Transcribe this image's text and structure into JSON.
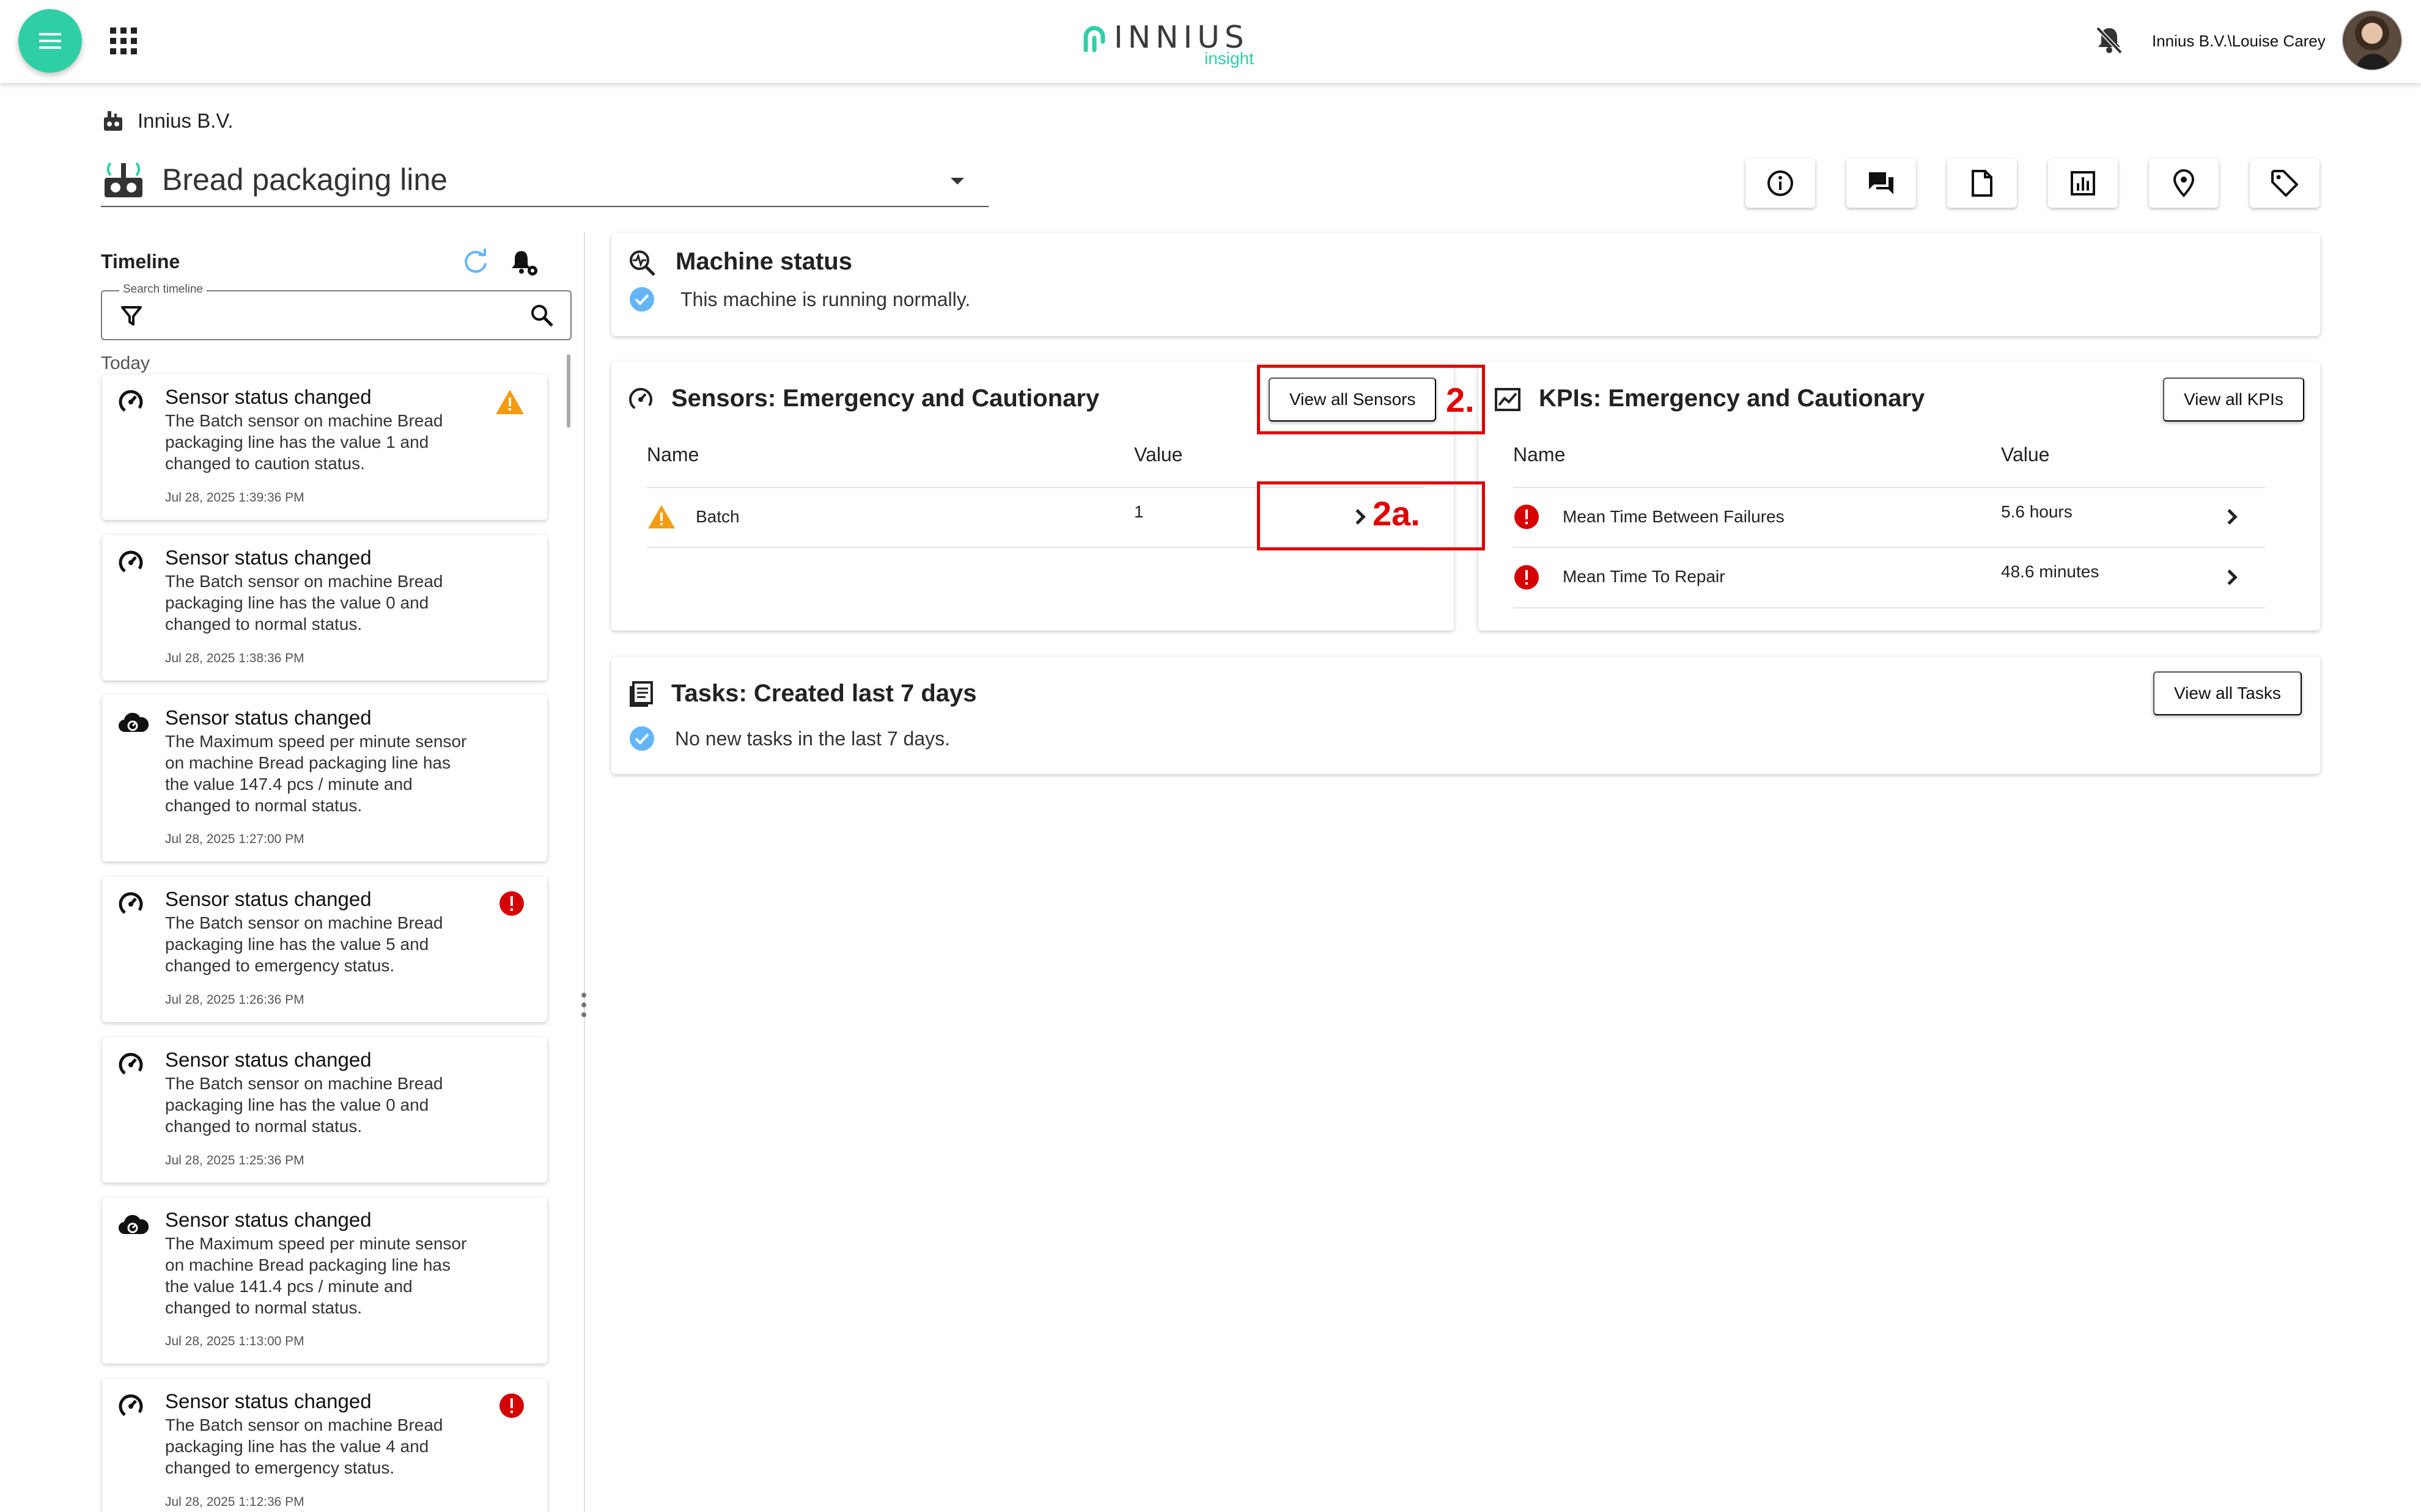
{
  "header": {
    "logo_word": "INNIUS",
    "logo_sub": "insight",
    "user": "Innius B.V.\\Louise Carey"
  },
  "breadcrumb": "Innius B.V.",
  "machine_selector": "Bread packaging line",
  "timeline": {
    "title": "Timeline",
    "search_label": "Search timeline",
    "search_value": "",
    "group": "Today",
    "items": [
      {
        "title": "Sensor status changed",
        "desc": "The Batch sensor on machine Bread packaging line has the value 1 and changed to caution status.",
        "time": "Jul 28, 2025 1:39:36 PM",
        "icon": "gauge-icon",
        "status": "caution"
      },
      {
        "title": "Sensor status changed",
        "desc": "The Batch sensor on machine Bread packaging line has the value 0 and changed to normal status.",
        "time": "Jul 28, 2025 1:38:36 PM",
        "icon": "gauge-icon",
        "status": "normal"
      },
      {
        "title": "Sensor status changed",
        "desc": "The Maximum speed per minute sensor on machine Bread packaging line has the value 147.4 pcs / minute and changed to normal status.",
        "time": "Jul 28, 2025 1:27:00 PM",
        "icon": "cloud-gauge-icon",
        "status": "normal"
      },
      {
        "title": "Sensor status changed",
        "desc": "The Batch sensor on machine Bread packaging line has the value 5 and changed to emergency status.",
        "time": "Jul 28, 2025 1:26:36 PM",
        "icon": "gauge-icon",
        "status": "emergency"
      },
      {
        "title": "Sensor status changed",
        "desc": "The Batch sensor on machine Bread packaging line has the value 0 and changed to normal status.",
        "time": "Jul 28, 2025 1:25:36 PM",
        "icon": "gauge-icon",
        "status": "normal"
      },
      {
        "title": "Sensor status changed",
        "desc": "The Maximum speed per minute sensor on machine Bread packaging line has the value 141.4 pcs / minute and changed to normal status.",
        "time": "Jul 28, 2025 1:13:00 PM",
        "icon": "cloud-gauge-icon",
        "status": "normal"
      },
      {
        "title": "Sensor status changed",
        "desc": "The Batch sensor on machine Bread packaging line has the value 4 and changed to emergency status.",
        "time": "Jul 28, 2025 1:12:36 PM",
        "icon": "gauge-icon",
        "status": "emergency"
      }
    ]
  },
  "machine_status": {
    "title": "Machine status",
    "text": "This machine is running normally."
  },
  "sensors": {
    "title": "Sensors: Emergency and Cautionary",
    "button": "View all Sensors",
    "col_name": "Name",
    "col_value": "Value",
    "rows": [
      {
        "name": "Batch",
        "value": "1",
        "status": "caution"
      }
    ]
  },
  "kpis": {
    "title": "KPIs: Emergency and Cautionary",
    "button": "View all KPIs",
    "col_name": "Name",
    "col_value": "Value",
    "rows": [
      {
        "name": "Mean Time Between Failures",
        "value": "5.6 hours",
        "status": "emergency"
      },
      {
        "name": "Mean Time To Repair",
        "value": "48.6 minutes",
        "status": "emergency"
      }
    ]
  },
  "tasks": {
    "title": "Tasks: Created last 7 days",
    "button": "View all Tasks",
    "text": "No new tasks in the last 7 days."
  },
  "annotations": {
    "a1": "2.",
    "a2": "2a."
  },
  "colors": {
    "accent": "#2fcfa6",
    "caution": "#f39c12",
    "emergency": "#d50000",
    "ok": "#64b5f6",
    "annotation": "#e00000"
  }
}
